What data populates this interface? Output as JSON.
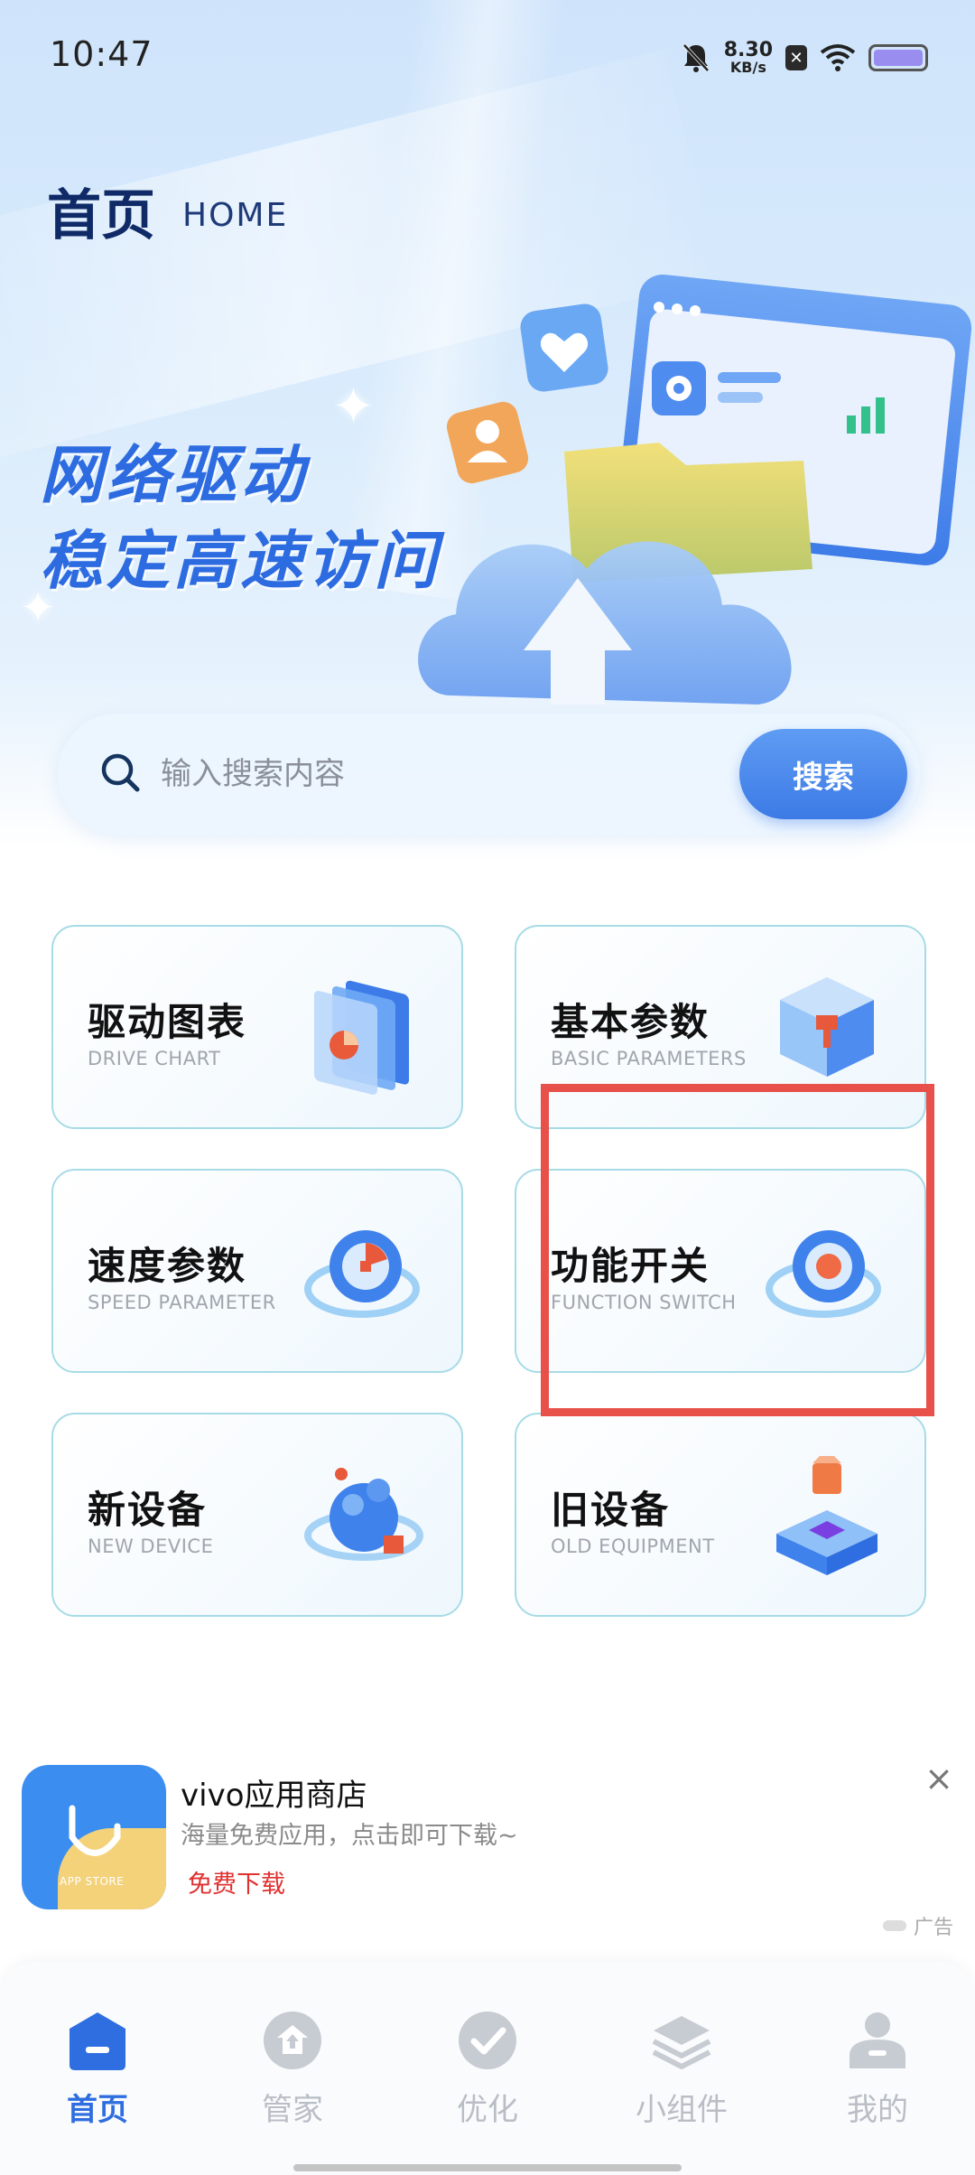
{
  "status_bar": {
    "time": "10:47",
    "net_speed_value": "8.30",
    "net_speed_unit": "KB/s",
    "sim_icon_text": "✕",
    "icons": [
      "bell-muted-icon",
      "sim-icon",
      "wifi-icon",
      "battery-icon"
    ]
  },
  "header": {
    "title": "首页",
    "subtitle": "HOME"
  },
  "banner": {
    "line1": "网络驱动",
    "line2": "稳定高速访问"
  },
  "search": {
    "placeholder": "输入搜索内容",
    "button_label": "搜索"
  },
  "grid": [
    {
      "cn": "驱动图表",
      "en": "DRIVE CHART",
      "icon": "chart-cube-icon"
    },
    {
      "cn": "基本参数",
      "en": "BASIC PARAMETERS",
      "icon": "cube-icon"
    },
    {
      "cn": "速度参数",
      "en": "SPEED PARAMETER",
      "icon": "speed-dial-icon"
    },
    {
      "cn": "功能开关",
      "en": "FUNCTION SWITCH",
      "icon": "switch-ring-icon"
    },
    {
      "cn": "新设备",
      "en": "NEW DEVICE",
      "icon": "planet-icon"
    },
    {
      "cn": "旧设备",
      "en": "OLD EQUIPMENT",
      "icon": "stack-box-icon"
    }
  ],
  "ad": {
    "title": "vivo应用商店",
    "subtitle": "海量免费应用，点击即可下载~",
    "cta": "免费下载",
    "label": "广告",
    "close": "×",
    "app_icon_text": "APP STORE"
  },
  "bottom_nav": [
    {
      "label": "首页",
      "icon": "home-icon",
      "active": true
    },
    {
      "label": "管家",
      "icon": "house-arrow-icon",
      "active": false
    },
    {
      "label": "优化",
      "icon": "check-circle-icon",
      "active": false
    },
    {
      "label": "小组件",
      "icon": "layers-icon",
      "active": false
    },
    {
      "label": "我的",
      "icon": "user-icon",
      "active": false
    }
  ],
  "colors": {
    "accent": "#3c7ae6",
    "highlight": "#e8504a",
    "card_border": "#a7dbe6",
    "cta_red": "#e03030"
  }
}
